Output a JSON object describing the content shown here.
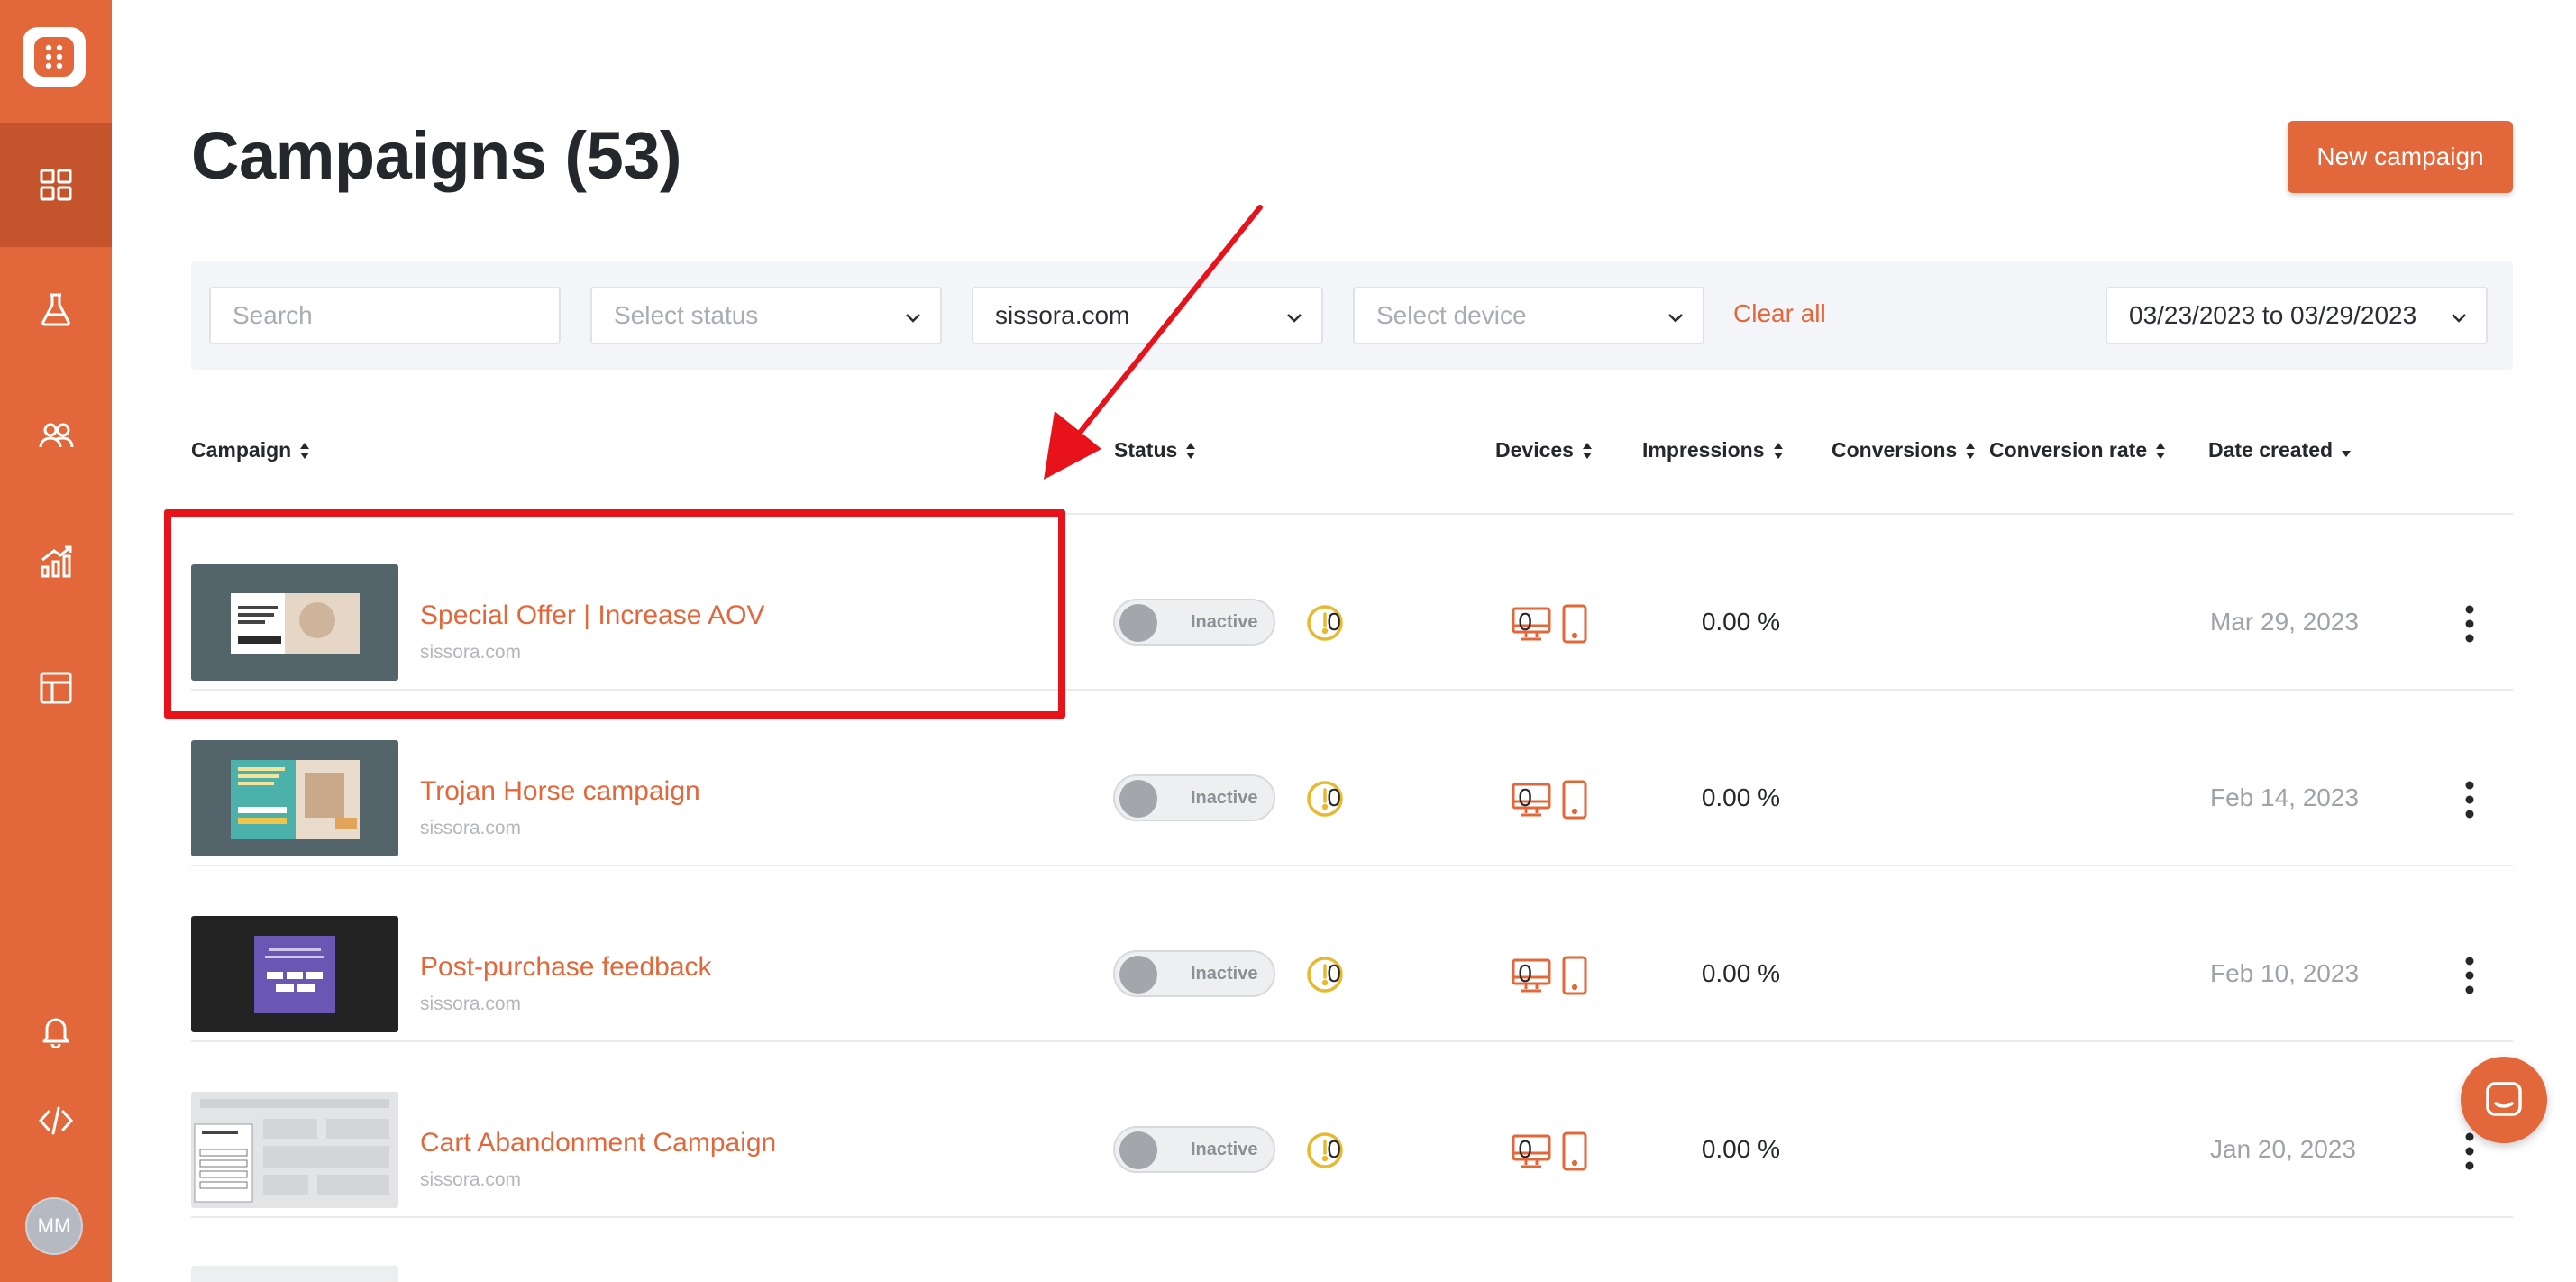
{
  "app": {
    "avatar_initials": "MM"
  },
  "sidebar": {
    "items": [
      {
        "icon": "dashboard-grid-icon",
        "active": true
      },
      {
        "icon": "flask-icon",
        "active": false
      },
      {
        "icon": "users-icon",
        "active": false
      },
      {
        "icon": "analytics-chart-icon",
        "active": false
      },
      {
        "icon": "layout-template-icon",
        "active": false
      },
      {
        "icon": "bell-icon",
        "active": false
      },
      {
        "icon": "code-icon",
        "active": false
      }
    ]
  },
  "header": {
    "title": "Campaigns (53)",
    "new_button": "New campaign"
  },
  "filters": {
    "search_placeholder": "Search",
    "status_placeholder": "Select status",
    "site_value": "sissora.com",
    "device_placeholder": "Select device",
    "clear_all": "Clear all",
    "date_range": "03/23/2023 to 03/29/2023"
  },
  "table": {
    "columns": {
      "campaign": "Campaign",
      "status": "Status",
      "devices": "Devices",
      "impressions": "Impressions",
      "conversions": "Conversions",
      "conversion_rate": "Conversion rate",
      "date_created": "Date created"
    },
    "rows": [
      {
        "name": "Special Offer | Increase AOV",
        "domain": "sissora.com",
        "status": "Inactive",
        "impressions": "0",
        "conversions": "0",
        "conversion_rate": "0.00 %",
        "date": "Mar 29, 2023"
      },
      {
        "name": "Trojan Horse campaign",
        "domain": "sissora.com",
        "status": "Inactive",
        "impressions": "0",
        "conversions": "0",
        "conversion_rate": "0.00 %",
        "date": "Feb 14, 2023"
      },
      {
        "name": "Post-purchase feedback",
        "domain": "sissora.com",
        "status": "Inactive",
        "impressions": "0",
        "conversions": "0",
        "conversion_rate": "0.00 %",
        "date": "Feb 10, 2023"
      },
      {
        "name": "Cart Abandonment Campaign",
        "domain": "sissora.com",
        "status": "Inactive",
        "impressions": "0",
        "conversions": "0",
        "conversion_rate": "0.00 %",
        "date": "Jan 20, 2023"
      }
    ]
  },
  "colors": {
    "accent": "#e2673a",
    "highlight": "#e8121a",
    "warning": "#e8b92e"
  }
}
